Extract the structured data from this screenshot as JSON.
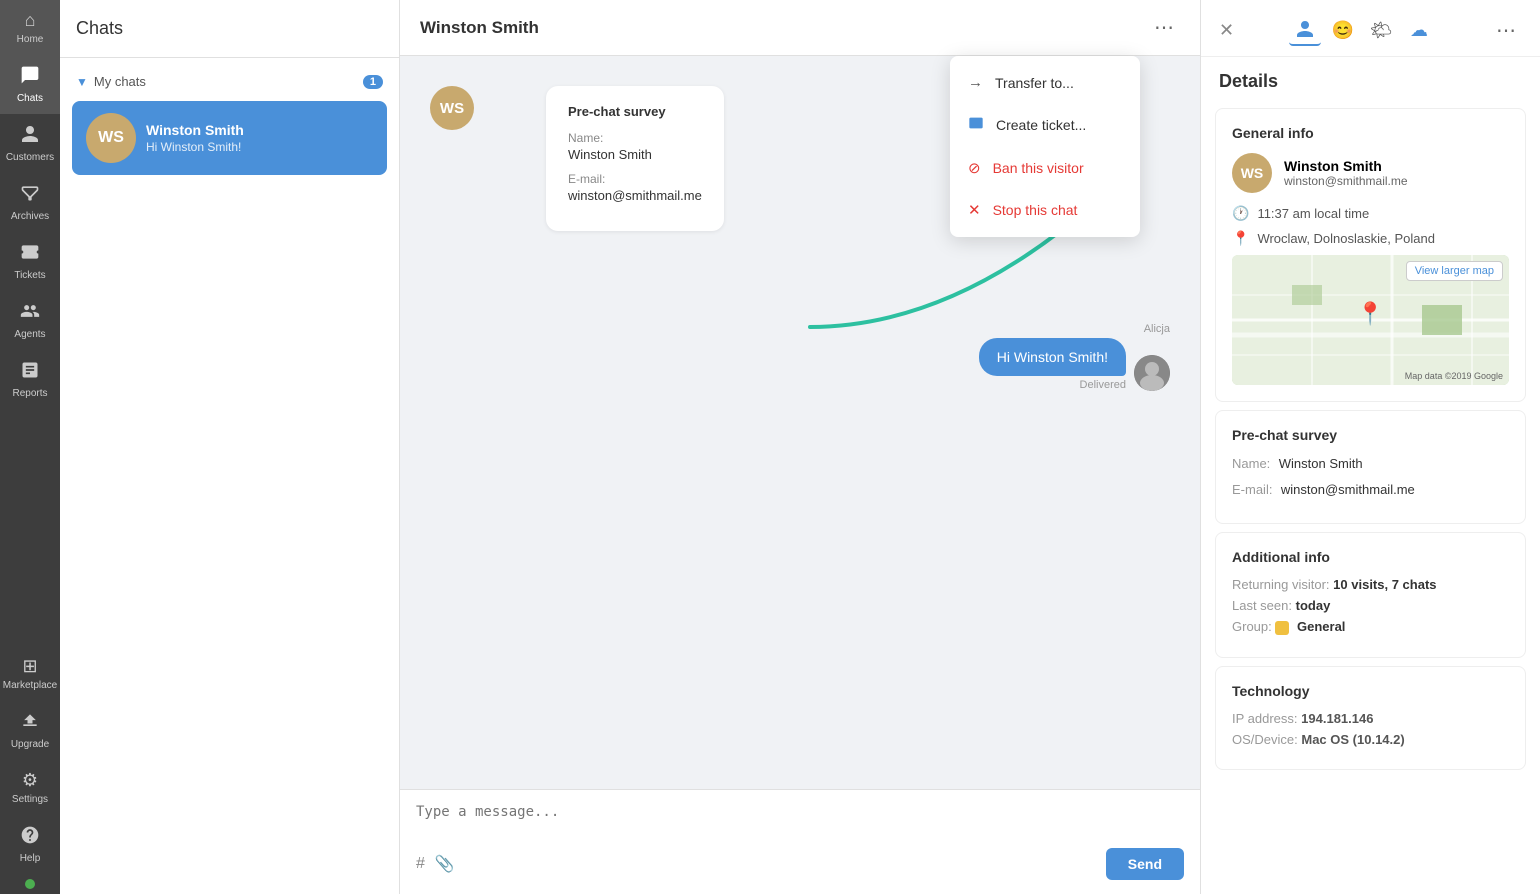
{
  "nav": {
    "items": [
      {
        "id": "home",
        "label": "Home",
        "icon": "⌂"
      },
      {
        "id": "chats",
        "label": "Chats",
        "icon": "💬",
        "active": true
      },
      {
        "id": "customers",
        "label": "Customers",
        "icon": "👤"
      },
      {
        "id": "archives",
        "label": "Archives",
        "icon": "📦"
      },
      {
        "id": "tickets",
        "label": "Tickets",
        "icon": "🎫"
      },
      {
        "id": "agents",
        "label": "Agents",
        "icon": "👥"
      },
      {
        "id": "reports",
        "label": "Reports",
        "icon": "📊"
      },
      {
        "id": "marketplace",
        "label": "Marketplace",
        "icon": "⊞"
      },
      {
        "id": "upgrade",
        "label": "Upgrade",
        "icon": "⬆"
      },
      {
        "id": "settings",
        "label": "Settings",
        "icon": "⚙"
      },
      {
        "id": "help",
        "label": "Help",
        "icon": "?"
      }
    ]
  },
  "chat_list": {
    "title": "Chats",
    "my_chats_label": "My chats",
    "my_chats_count": "1",
    "contacts": [
      {
        "id": "winston",
        "initials": "WS",
        "name": "Winston Smith",
        "preview": "Hi Winston Smith!",
        "active": true
      }
    ]
  },
  "chat_window": {
    "title": "Winston Smith",
    "survey_card": {
      "title": "Pre-chat survey",
      "fields": [
        {
          "label": "Name:",
          "value": "Winston Smith"
        },
        {
          "label": "E-mail:",
          "value": "winston@smithmail.me"
        }
      ]
    },
    "messages": [
      {
        "sender": "agent",
        "agent_name": "Alicja",
        "text": "Hi Winston Smith!",
        "status": "Delivered"
      }
    ],
    "input_placeholder": "Type a message...",
    "send_label": "Send"
  },
  "dropdown_menu": {
    "items": [
      {
        "id": "transfer",
        "label": "Transfer to...",
        "icon": "→"
      },
      {
        "id": "create_ticket",
        "label": "Create ticket...",
        "icon": "🎫"
      },
      {
        "id": "ban",
        "label": "Ban this visitor",
        "icon": "🚫"
      },
      {
        "id": "stop",
        "label": "Stop this chat",
        "icon": "✕"
      }
    ]
  },
  "details": {
    "title": "Details",
    "more_icon": "⋯",
    "general_info": {
      "title": "General info",
      "initials": "WS",
      "name": "Winston Smith",
      "email": "winston@smithmail.me",
      "local_time": "11:37 am local time",
      "location": "Wroclaw, Dolnoslaskie, Poland",
      "map_link": "View larger map"
    },
    "pre_chat_survey": {
      "title": "Pre-chat survey",
      "fields": [
        {
          "label": "Name:",
          "value": "Winston Smith"
        },
        {
          "label": "E-mail:",
          "value": "winston@smithmail.me"
        }
      ]
    },
    "additional_info": {
      "title": "Additional info",
      "returning_visitor_label": "Returning visitor:",
      "returning_visitor_value": "10 visits, 7 chats",
      "last_seen_label": "Last seen:",
      "last_seen_value": "today",
      "group_label": "Group:",
      "group_value": "General"
    },
    "technology": {
      "title": "Technology",
      "ip_label": "IP address:",
      "ip_value": "194.181.146",
      "os_label": "OS/Device:",
      "os_value": "Mac OS (10.14.2)"
    }
  }
}
